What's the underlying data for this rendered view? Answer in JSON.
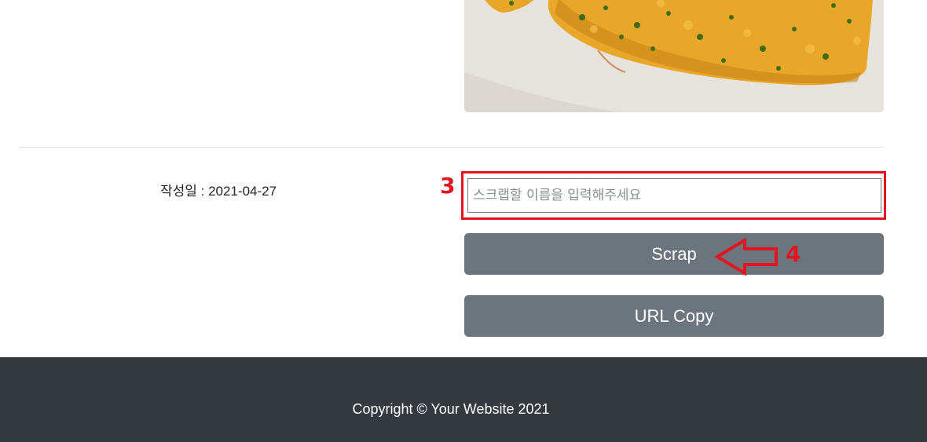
{
  "post": {
    "date_label": "작성일 : 2021-04-27",
    "image_alt": "omelette photo"
  },
  "scrap": {
    "input_placeholder": "스크랩할 이름을 입력해주세요",
    "input_value": "",
    "scrap_label": "Scrap",
    "copy_label": "URL Copy"
  },
  "annotations": {
    "box_label": "3",
    "arrow_label": "4",
    "color": "#e4141e"
  },
  "footer": {
    "copyright": "Copyright © Your Website 2021"
  },
  "colors": {
    "button": "#6c757d",
    "footer": "#343a40"
  }
}
